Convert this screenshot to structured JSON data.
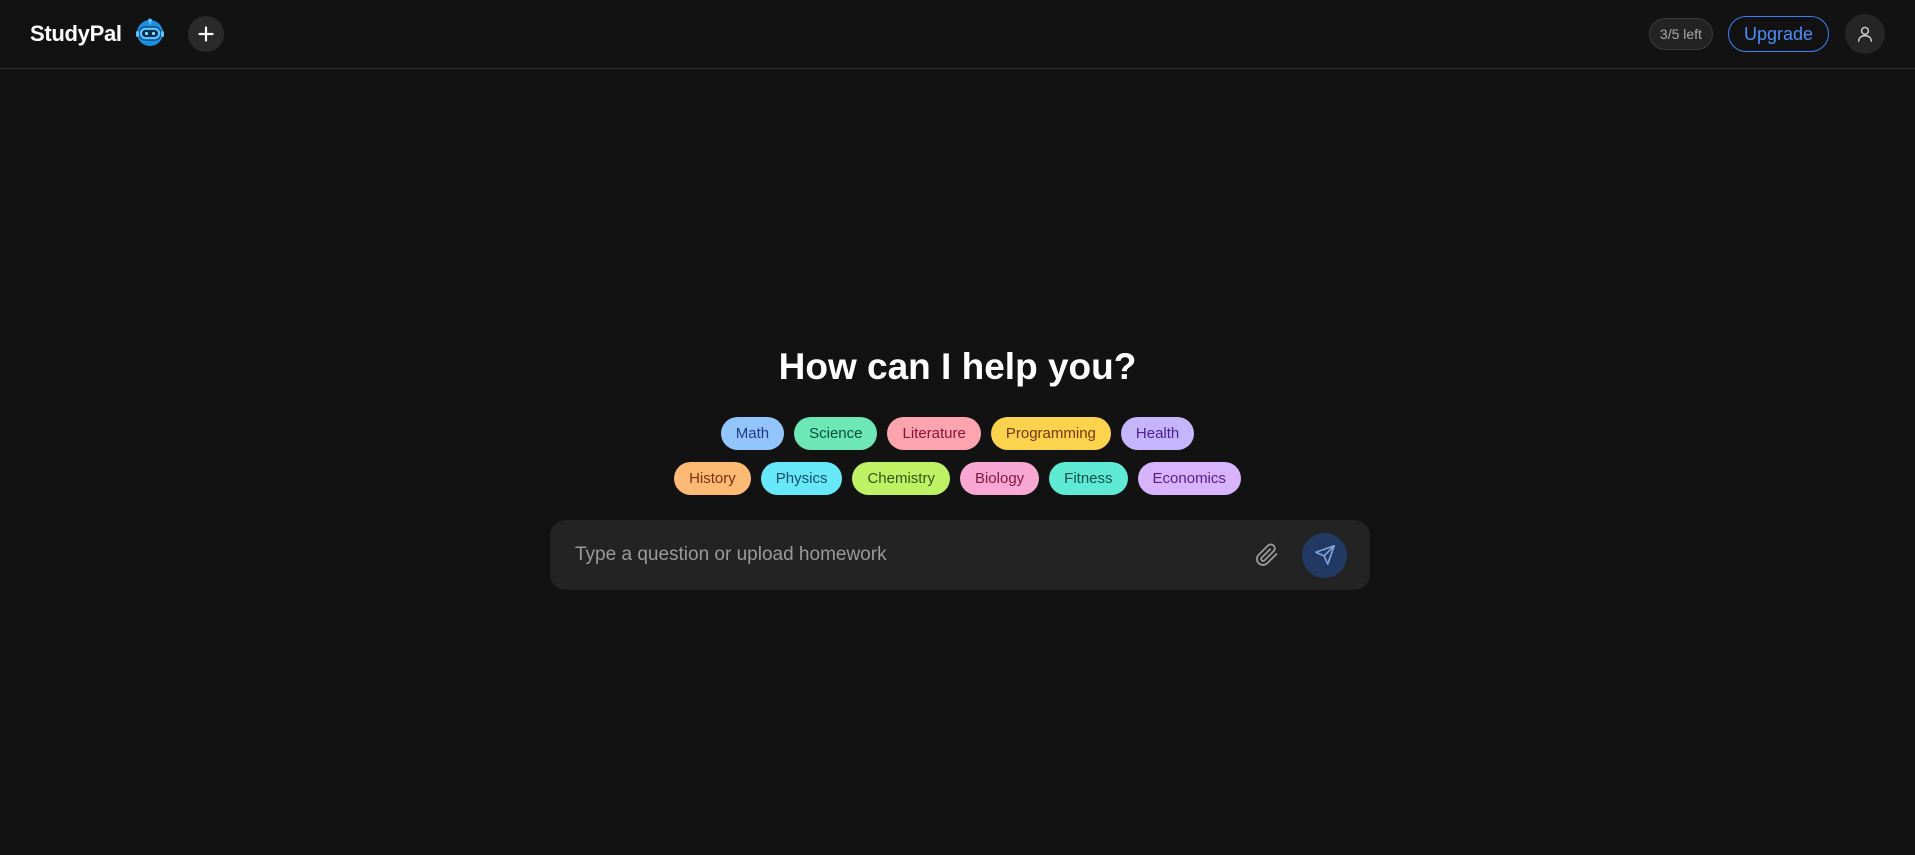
{
  "header": {
    "brand_name": "StudyPal",
    "logo_icon": "robot-logo-icon",
    "new_chat_icon": "plus-icon",
    "quota_text": "3/5 left",
    "upgrade_label": "Upgrade",
    "user_icon": "user-icon"
  },
  "main": {
    "heading": "How can I help you?",
    "tag_rows": [
      [
        {
          "label": "Math",
          "bg": "#93c5fd",
          "fg": "#1e3a8a"
        },
        {
          "label": "Science",
          "bg": "#6ee7b7",
          "fg": "#064e3b"
        },
        {
          "label": "Literature",
          "bg": "#fda4af",
          "fg": "#881337"
        },
        {
          "label": "Programming",
          "bg": "#fcd34d",
          "fg": "#78350f"
        },
        {
          "label": "Health",
          "bg": "#c4b5fd",
          "fg": "#4c1d95"
        }
      ],
      [
        {
          "label": "History",
          "bg": "#fdba74",
          "fg": "#7c2d12"
        },
        {
          "label": "Physics",
          "bg": "#67e8f9",
          "fg": "#164e63"
        },
        {
          "label": "Chemistry",
          "bg": "#bef264",
          "fg": "#365314"
        },
        {
          "label": "Biology",
          "bg": "#f9a8d4",
          "fg": "#831843"
        },
        {
          "label": "Fitness",
          "bg": "#5eead4",
          "fg": "#134e4a"
        },
        {
          "label": "Economics",
          "bg": "#d8b4fe",
          "fg": "#581c87"
        }
      ]
    ]
  },
  "composer": {
    "placeholder": "Type a question or upload homework",
    "value": "",
    "attach_icon": "paperclip-icon",
    "send_icon": "send-icon"
  },
  "colors": {
    "background": "#121212",
    "accent": "#3b82f6",
    "send_button": "#223a63"
  }
}
